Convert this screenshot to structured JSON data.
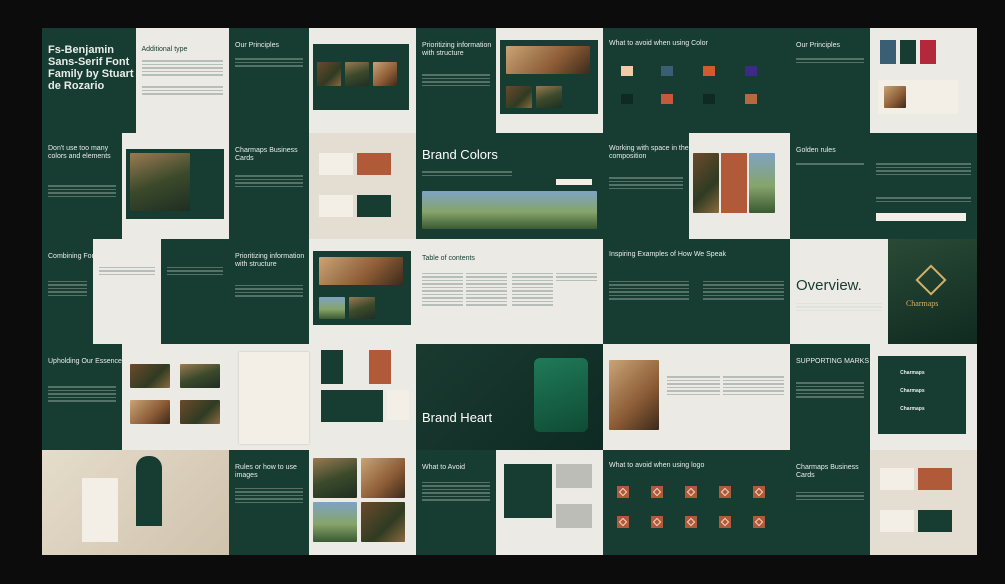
{
  "colors": {
    "background": "#0c0c0d",
    "green": "#173c31",
    "light": "#eceae4",
    "rust": "#b05a3a",
    "cream": "#f3efe6"
  },
  "slides": {
    "cover_title": "Fs-Benjamin Sans-Serif Font Family by Stuart de Rozario",
    "additional_type": "Additional type",
    "our_principles_1": "Our Principles",
    "prioritizing_1": "Prioritizing information with structure",
    "avoid_color": "What to avoid when using Color",
    "our_principles_2": "Our Principles",
    "dont_use": "Don't use too many colors and elements",
    "business_cards_1": "Charmaps Business Cards",
    "brand_colors": "Brand Colors",
    "working_space": "Working with space in the composition",
    "golden_rules": "Golden rules",
    "combining_fonts": "Combining Fonts",
    "prioritizing_2": "Prioritizing information with structure",
    "toc": "Table of contents",
    "inspiring": "Inspiring Examples of How We Speak",
    "overview": "Overview.",
    "overview_logo": "Charmaps",
    "upholding": "Upholding Our Essence",
    "brand_heart": "Brand Heart",
    "supporting_marks": "SUPPORTING MARKS",
    "supporting_mark_label": "Charmaps",
    "rules_images": "Rules or how to use images",
    "what_to_avoid": "What to Avoid",
    "avoid_logo": "What to avoid when using logo",
    "business_cards_2": "Charmaps Business Cards"
  }
}
